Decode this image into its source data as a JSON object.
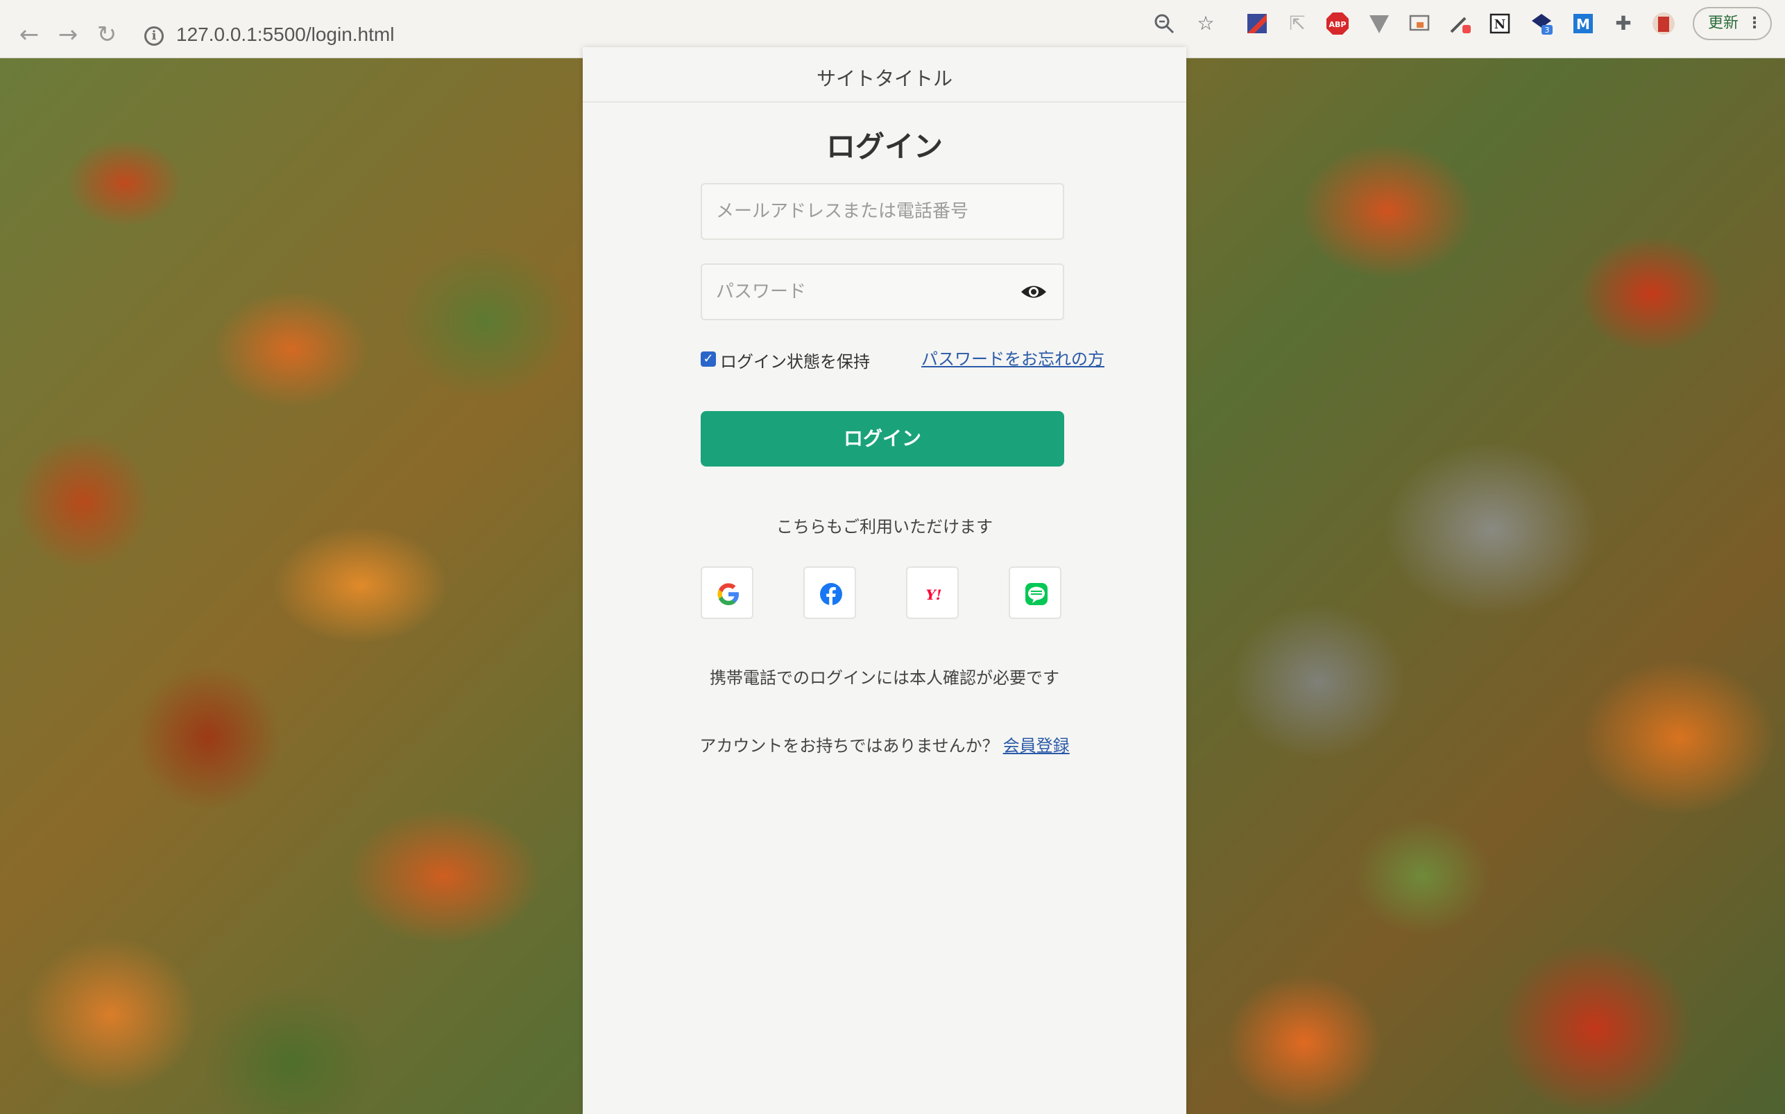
{
  "browser": {
    "url": "127.0.0.1:5500/login.html",
    "update_label": "更新",
    "toolbar_icons": [
      "zoom-icon",
      "bookmark-star-icon",
      "extension-icon",
      "cursor-extension-icon",
      "adblock-icon",
      "vuetify-extension-icon",
      "screen-capture-icon",
      "color-picker-icon",
      "notion-icon",
      "extension-badge-icon",
      "m-extension-icon",
      "puzzle-extensions-icon",
      "profile-avatar-icon"
    ],
    "adblock_label": "ABP",
    "notion_label": "N",
    "m_label": "M",
    "badge_count": "3"
  },
  "site": {
    "title": "サイトタイトル"
  },
  "login": {
    "heading": "ログイン",
    "email_placeholder": "メールアドレスまたは電話番号",
    "password_placeholder": "パスワード",
    "remember_label": "ログイン状態を保持",
    "remember_checked": true,
    "forgot_link": "パスワードをお忘れの方",
    "submit_label": "ログイン",
    "alt_text": "こちらもご利用いただけます",
    "social": [
      "google-icon",
      "facebook-icon",
      "yahoo-icon",
      "line-icon"
    ],
    "yahoo_label": "Y!",
    "mobile_note": "携帯電話でのログインには本人確認が必要です",
    "signup_prompt": "アカウントをお持ちではありませんか？",
    "signup_link": "会員登録"
  },
  "colors": {
    "primary_button": "#1aa37a",
    "link": "#2a5aa8",
    "checkbox": "#2a66c9"
  }
}
